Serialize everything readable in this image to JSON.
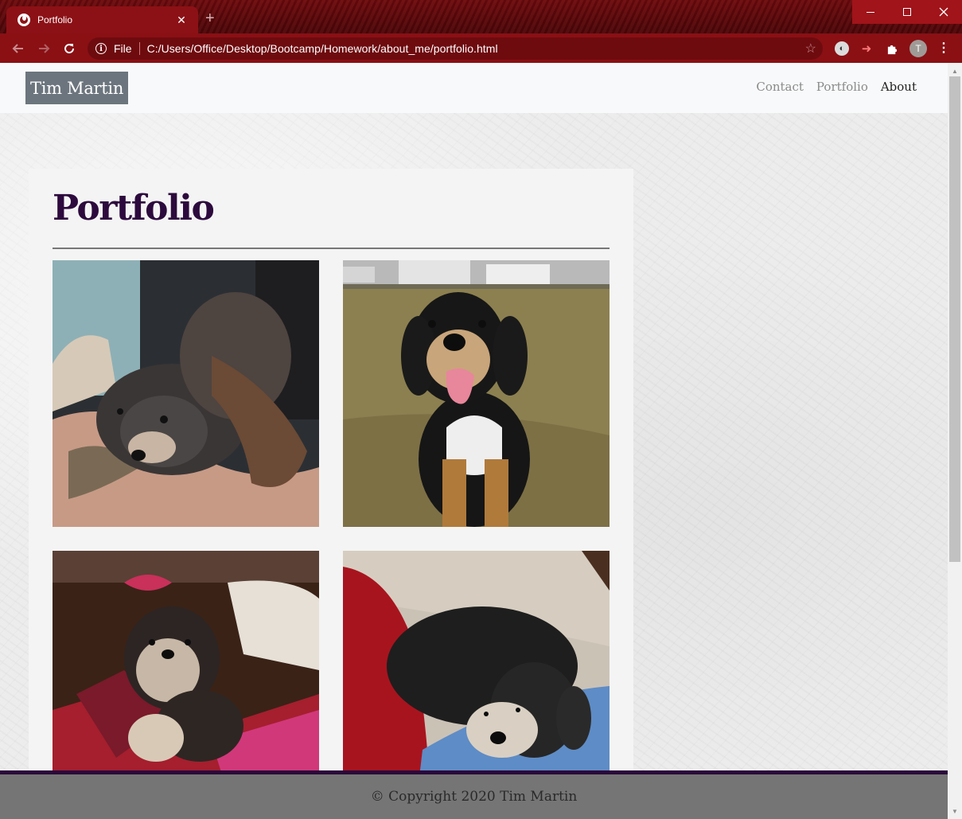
{
  "browser": {
    "tab_title": "Portfolio",
    "tab_close_glyph": "✕",
    "new_tab_glyph": "+",
    "omnibox": {
      "scheme_label": "File",
      "url": "C:/Users/Office/Desktop/Bootcamp/Homework/about_me/portfolio.html"
    },
    "profile_initial": "T",
    "icons": [
      "back-arrow-icon",
      "forward-arrow-icon",
      "reload-icon",
      "info-icon",
      "star-icon",
      "extension-icon",
      "puzzle-icon",
      "menu-dots-icon"
    ],
    "theme_colors": {
      "frame": "#6e0a0d",
      "toolbar": "#8a1014"
    }
  },
  "site": {
    "brand": "Tim Martin",
    "nav": [
      {
        "label": "Contact",
        "active": false
      },
      {
        "label": "Portfolio",
        "active": false
      },
      {
        "label": "About",
        "active": true
      }
    ],
    "page_title": "Portfolio",
    "photos": [
      {
        "subject": "dog lying on blanket",
        "colors": [
          "#3a3a3a",
          "#6b5a4c"
        ]
      },
      {
        "subject": "dog sitting on grass",
        "colors": [
          "#8a7a4a",
          "#1a1a1a"
        ]
      },
      {
        "subject": "dog on red blanket",
        "colors": [
          "#6a2a2e",
          "#c23a5a"
        ]
      },
      {
        "subject": "dog lying on blue pillow",
        "colors": [
          "#c9bfb4",
          "#5a82b0"
        ]
      }
    ],
    "footer": "© Copyright 2020 Tim Martin",
    "colors": {
      "title": "#2d0a3d",
      "brand_bg": "#6c757d",
      "footer_bg": "#757575",
      "footer_border": "#2a0a3a"
    }
  }
}
